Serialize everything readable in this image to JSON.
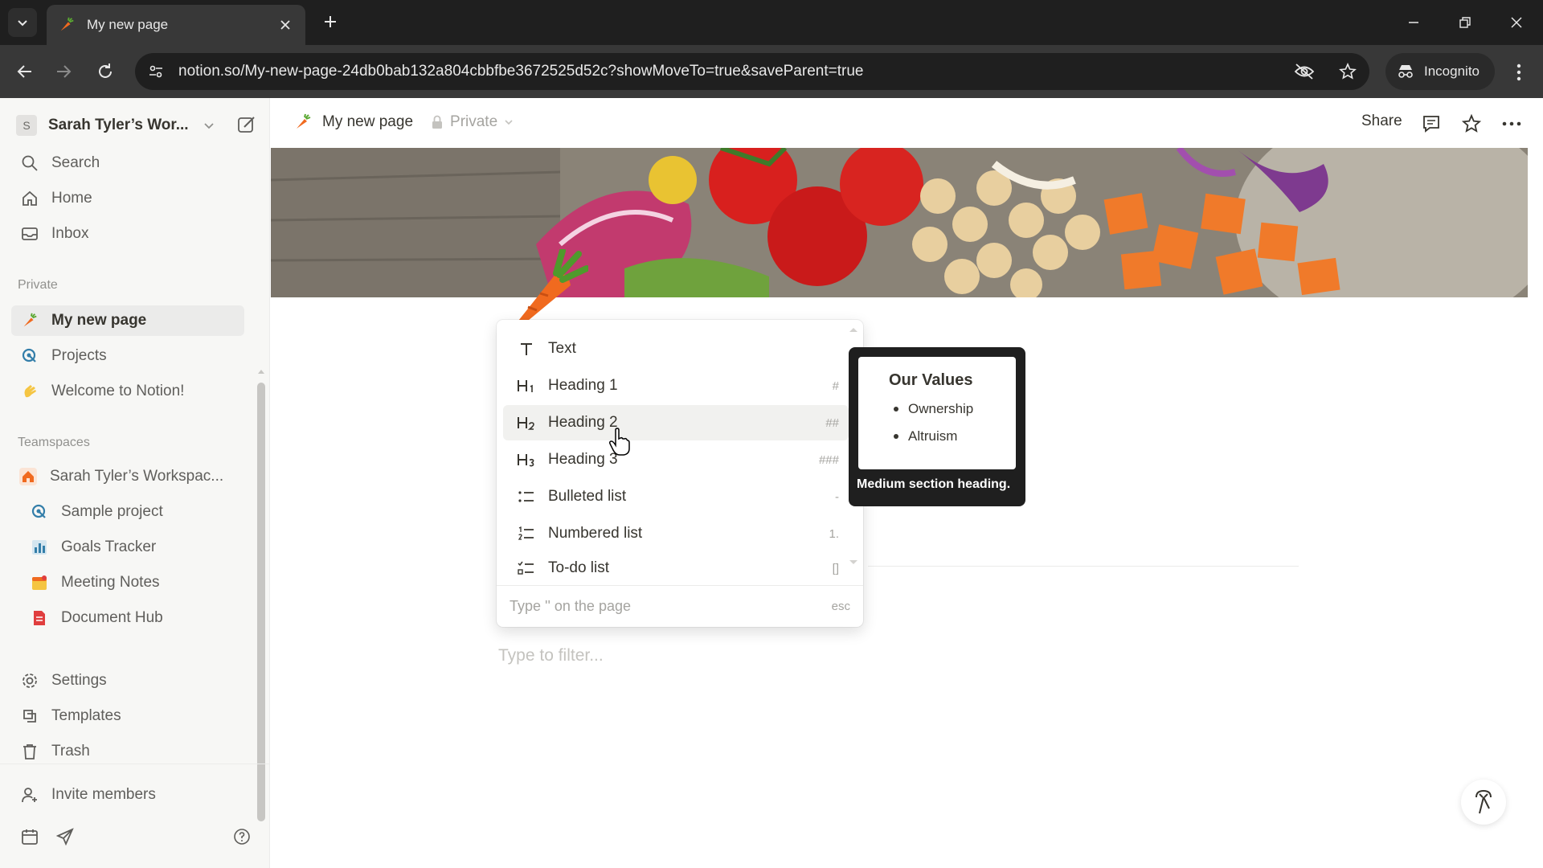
{
  "browser": {
    "tab_title": "My new page",
    "url": "notion.so/My-new-page-24db0bab132a804cbbfbe3672525d52c?showMoveTo=true&saveParent=true",
    "incognito_label": "Incognito"
  },
  "sidebar": {
    "workspace_initial": "S",
    "workspace_name": "Sarah Tyler’s Wor...",
    "top_items": [
      {
        "label": "Search",
        "icon": "search-icon"
      },
      {
        "label": "Home",
        "icon": "home-icon"
      },
      {
        "label": "Inbox",
        "icon": "inbox-icon"
      }
    ],
    "private_label": "Private",
    "private_items": [
      {
        "label": "My new page",
        "icon": "carrot-icon",
        "active": true
      },
      {
        "label": "Projects",
        "icon": "projects-icon"
      },
      {
        "label": "Welcome to Notion!",
        "icon": "wave-icon"
      }
    ],
    "teamspaces_label": "Teamspaces",
    "teamspace_items": [
      {
        "label": "Sarah Tyler’s Workspac...",
        "icon": "house-icon"
      },
      {
        "label": "Sample project",
        "icon": "projects-icon"
      },
      {
        "label": "Goals Tracker",
        "icon": "chart-icon"
      },
      {
        "label": "Meeting Notes",
        "icon": "calendar-icon"
      },
      {
        "label": "Document Hub",
        "icon": "document-icon"
      }
    ],
    "bottom_items": [
      {
        "label": "Settings",
        "icon": "gear-icon"
      },
      {
        "label": "Templates",
        "icon": "templates-icon"
      },
      {
        "label": "Trash",
        "icon": "trash-icon"
      }
    ],
    "invite_label": "Invite members"
  },
  "topbar": {
    "page_title": "My new page",
    "privacy": "Private",
    "share_label": "Share"
  },
  "slash_menu": {
    "items": [
      {
        "label": "Text",
        "icon": "T",
        "shortcut": ""
      },
      {
        "label": "Heading 1",
        "icon": "H1",
        "shortcut": "#"
      },
      {
        "label": "Heading 2",
        "icon": "H2",
        "shortcut": "##"
      },
      {
        "label": "Heading 3",
        "icon": "H3",
        "shortcut": "###"
      },
      {
        "label": "Bulleted list",
        "icon": "bulleted-list-icon",
        "shortcut": "-"
      },
      {
        "label": "Numbered list",
        "icon": "numbered-list-icon",
        "shortcut": "1."
      },
      {
        "label": "To-do list",
        "icon": "todo-list-icon",
        "shortcut": "[]"
      }
    ],
    "hovered_index": 2,
    "footer_hint": "Type '' on the page",
    "footer_esc": "esc"
  },
  "preview": {
    "heading": "Our Values",
    "bullets": [
      "Ownership",
      "Altruism"
    ],
    "caption": "Medium section heading."
  },
  "editor": {
    "filter_placeholder": "Type to filter..."
  },
  "colors": {
    "accent_orange": "#f06a1f",
    "hover_bg": "#f1f1ef",
    "sidebar_bg": "#f7f7f5"
  }
}
